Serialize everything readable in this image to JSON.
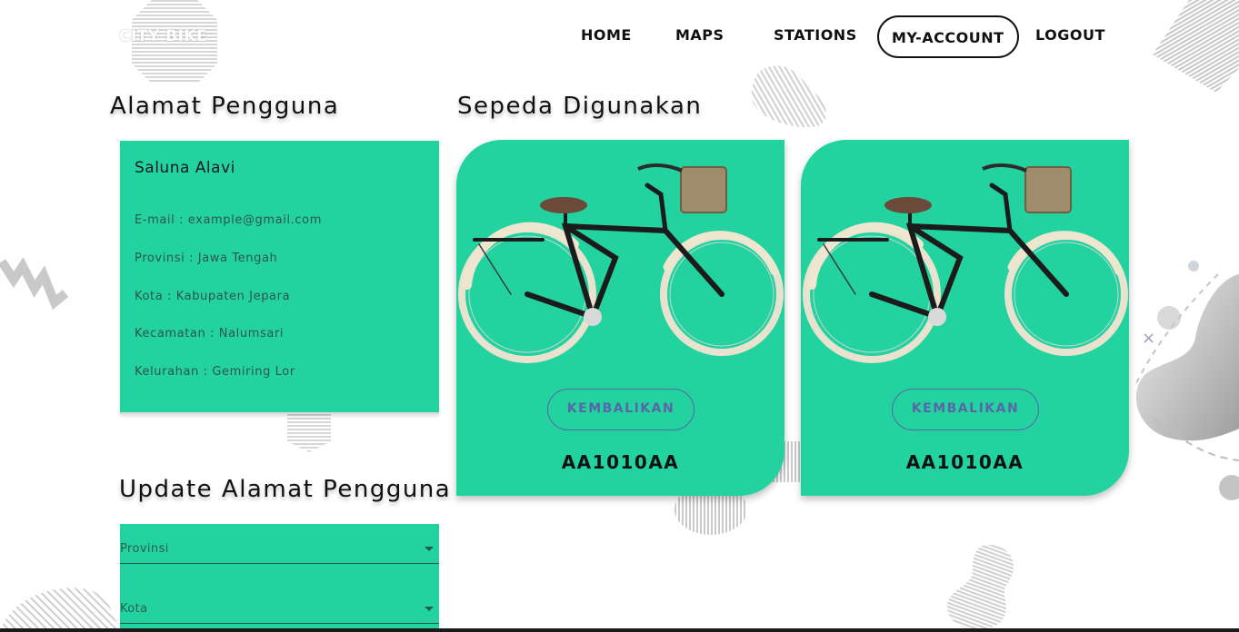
{
  "nav": {
    "logo": "CITY BIKE",
    "items": [
      "HOME",
      "MAPS",
      "STATIONS",
      "MY-ACCOUNT",
      "LOGOUT"
    ],
    "active": "MY-ACCOUNT"
  },
  "address": {
    "heading": "Alamat Pengguna",
    "name": "Saluna Alavi",
    "lines": [
      "E-mail : example@gmail.com",
      "Provinsi : Jawa Tengah",
      "Kota : Kabupaten Jepara",
      "Kecamatan : Nalumsari",
      "Kelurahan : Gemiring Lor"
    ]
  },
  "update": {
    "heading": "Update Alamat Pengguna",
    "fields": [
      "Provinsi",
      "Kota"
    ]
  },
  "bikes": {
    "heading": "Sepeda Digunakan",
    "items": [
      {
        "button": "KEMBALIKAN",
        "plate": "AA1010AA"
      },
      {
        "button": "KEMBALIKAN",
        "plate": "AA1010AA"
      }
    ]
  },
  "colors": {
    "accent": "#22d3a0",
    "button_outline": "#5a68a8",
    "text_dark": "#111111"
  }
}
